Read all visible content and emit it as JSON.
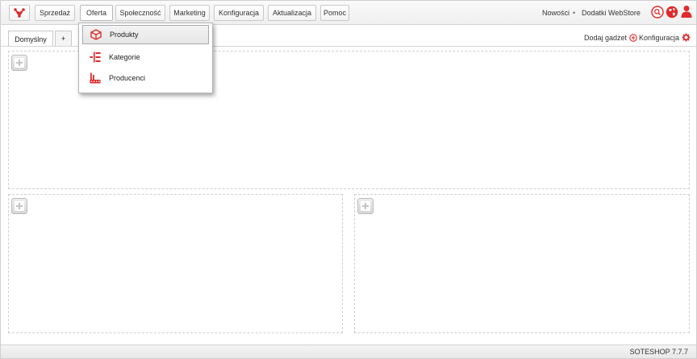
{
  "nav": {
    "logo_icon": "soteshop-logo-icon",
    "items": [
      {
        "label": "Sprzedaż"
      },
      {
        "label": "Oferta"
      },
      {
        "label": "Społeczność"
      },
      {
        "label": "Marketing"
      },
      {
        "label": "Konfiguracja"
      },
      {
        "label": "Aktualizacja"
      },
      {
        "label": "Pomoc"
      }
    ],
    "active": "Oferta"
  },
  "topright": {
    "news": "Nowości",
    "separator": "•",
    "addons": "Dodatki WebStore",
    "icons": [
      "search-icon",
      "globe-icon",
      "user-icon"
    ]
  },
  "tabs": {
    "items": [
      {
        "label": "Domyślny"
      },
      {
        "label": "+"
      }
    ],
    "active": "Domyślny"
  },
  "gadgets": {
    "add": "Dodaj gadżet",
    "config": "Konfiguracja"
  },
  "dropdown": {
    "items": [
      {
        "label": "Produkty",
        "icon": "box-icon"
      },
      {
        "label": "Kategorie",
        "icon": "category-tree-icon"
      },
      {
        "label": "Producenci",
        "icon": "factory-icon"
      }
    ],
    "highlighted": "Produkty"
  },
  "footer": {
    "version": "SOTESHOP 7.7.7"
  },
  "colors": {
    "accent": "#e02a2a"
  }
}
